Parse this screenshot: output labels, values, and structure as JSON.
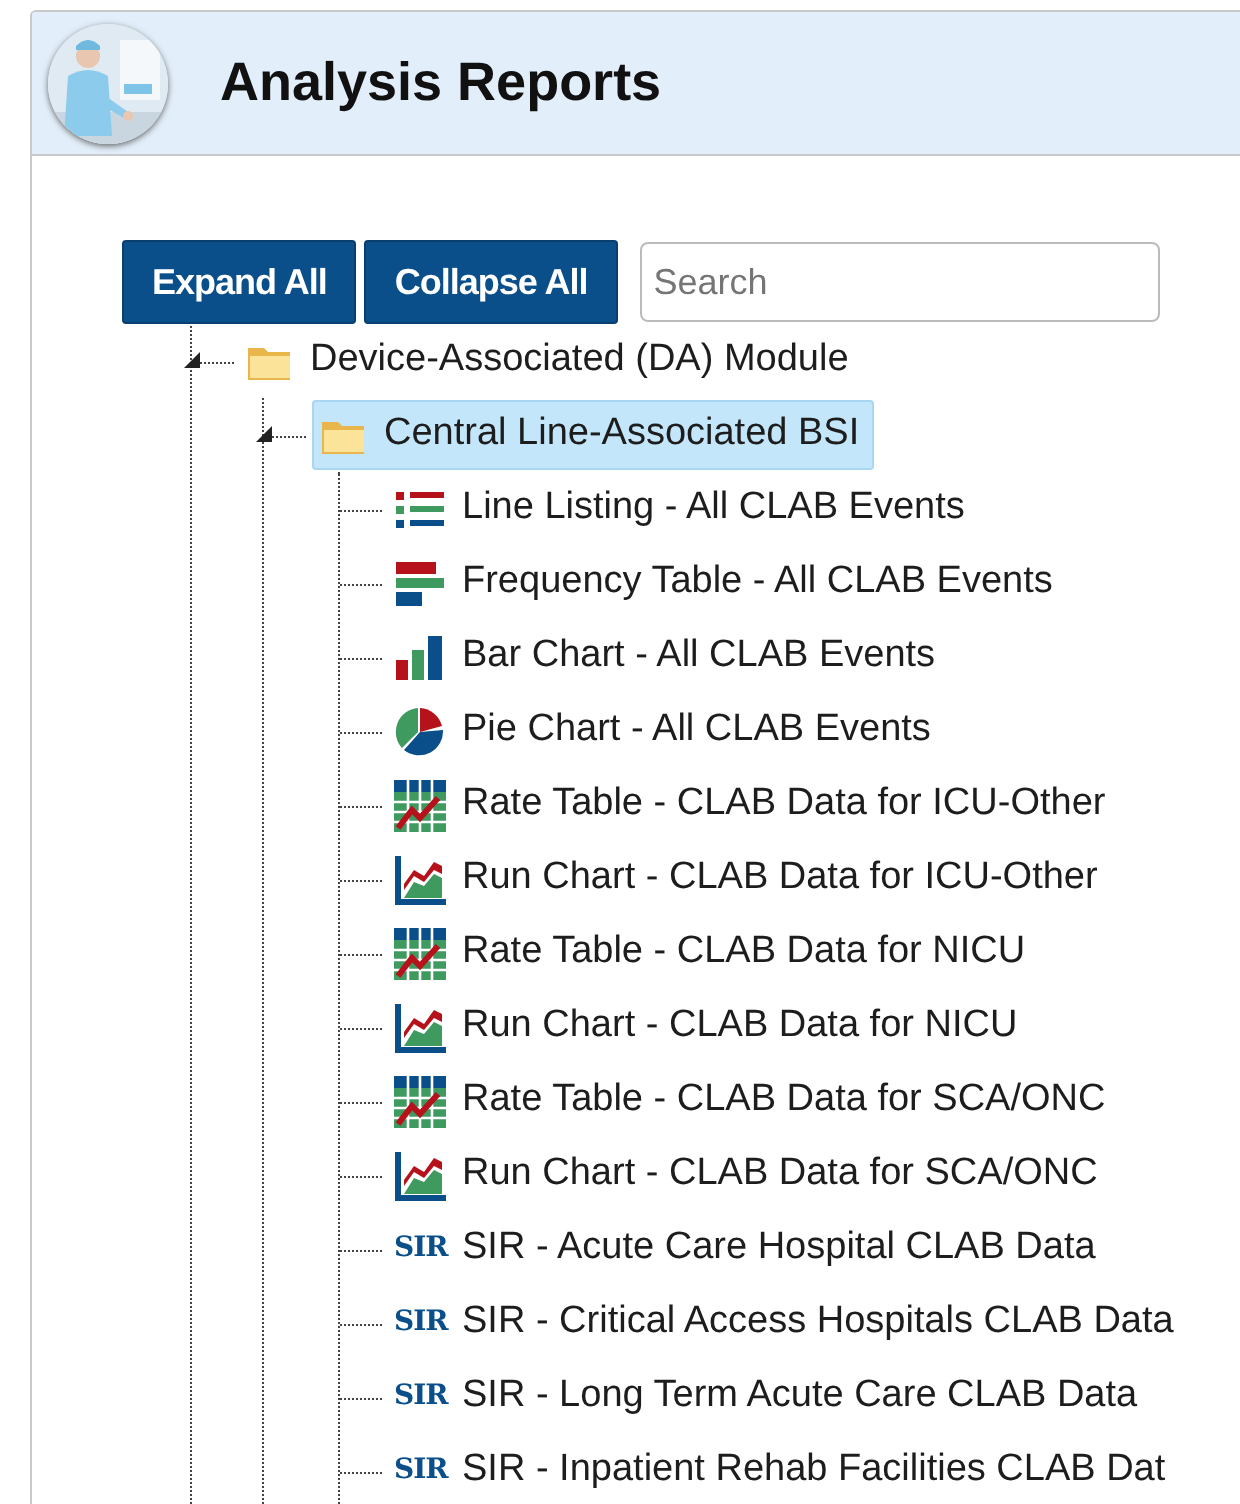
{
  "header": {
    "title": "Analysis Reports"
  },
  "toolbar": {
    "buttons": [
      "Expand All",
      "Collapse All"
    ],
    "search": {
      "placeholder": "Search"
    }
  },
  "tree": [
    {
      "label": "Device-Associated (DA) Module",
      "kind": "folder",
      "expanded": true,
      "selected": false,
      "children": [
        {
          "label": "Central Line-Associated BSI",
          "kind": "folder",
          "expanded": true,
          "selected": true,
          "children": [
            {
              "label": "Line Listing - All CLAB Events",
              "kind": "listing",
              "selected": false
            },
            {
              "label": "Frequency Table - All CLAB Events",
              "kind": "frequency",
              "selected": false
            },
            {
              "label": "Bar Chart - All CLAB Events",
              "kind": "bar",
              "selected": false
            },
            {
              "label": "Pie Chart - All CLAB Events",
              "kind": "pie",
              "selected": false
            },
            {
              "label": "Rate Table - CLAB Data for ICU-Other",
              "kind": "rate-table",
              "selected": false
            },
            {
              "label": "Run Chart - CLAB Data for ICU-Other",
              "kind": "run-chart",
              "selected": false
            },
            {
              "label": "Rate Table - CLAB Data for NICU",
              "kind": "rate-table",
              "selected": false
            },
            {
              "label": "Run Chart - CLAB Data for NICU",
              "kind": "run-chart",
              "selected": false
            },
            {
              "label": "Rate Table - CLAB Data for SCA/ONC",
              "kind": "rate-table",
              "selected": false
            },
            {
              "label": "Run Chart - CLAB Data for SCA/ONC",
              "kind": "run-chart",
              "selected": false
            },
            {
              "label": "SIR - Acute Care Hospital CLAB Data",
              "kind": "sir",
              "icon_text": "SIR",
              "selected": false
            },
            {
              "label": "SIR - Critical Access Hospitals CLAB Data",
              "kind": "sir",
              "icon_text": "SIR",
              "selected": false
            },
            {
              "label": "SIR - Long Term Acute Care CLAB Data",
              "kind": "sir",
              "icon_text": "SIR",
              "selected": false
            },
            {
              "label": "SIR - Inpatient Rehab Facilities CLAB Dat",
              "kind": "sir",
              "icon_text": "SIR",
              "selected": false
            }
          ]
        }
      ]
    }
  ]
}
